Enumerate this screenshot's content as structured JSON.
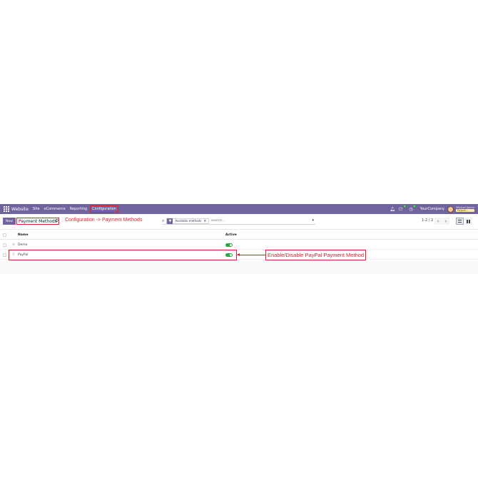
{
  "navbar": {
    "brand": "Website",
    "menu": [
      "Site",
      "eCommerce",
      "Reporting"
    ],
    "config_label": "Configuration",
    "chat_badge": "4",
    "activity_badge": "4",
    "company": "YourCompany",
    "user_name": "Mitchell Admin",
    "user_db": "Paypal..."
  },
  "control": {
    "new_label": "New",
    "breadcrumb": "Payment Methods",
    "annotation": "Configuration -> Payment Methods",
    "facet_label": "Available methods",
    "search_placeholder": "Search...",
    "pager": "1-2 / 2"
  },
  "table": {
    "columns": {
      "name": "Name",
      "active": "Active"
    },
    "rows": [
      {
        "name": "Demo",
        "active": true
      },
      {
        "name": "PayPal",
        "active": true
      }
    ]
  },
  "annotation_2": "Enable/Disable PayPal Payment Method",
  "colors": {
    "brand": "#71639e",
    "annotation": "#e11d2a",
    "toggle_on": "#28a745"
  },
  "icons": [
    "apps-icon",
    "gear-icon",
    "search-icon",
    "filter-icon",
    "close-icon",
    "caret-down-icon",
    "chevron-left-icon",
    "chevron-right-icon",
    "list-view-icon",
    "kanban-view-icon",
    "drag-handle-icon",
    "bell-icon",
    "chat-icon",
    "clock-icon"
  ]
}
